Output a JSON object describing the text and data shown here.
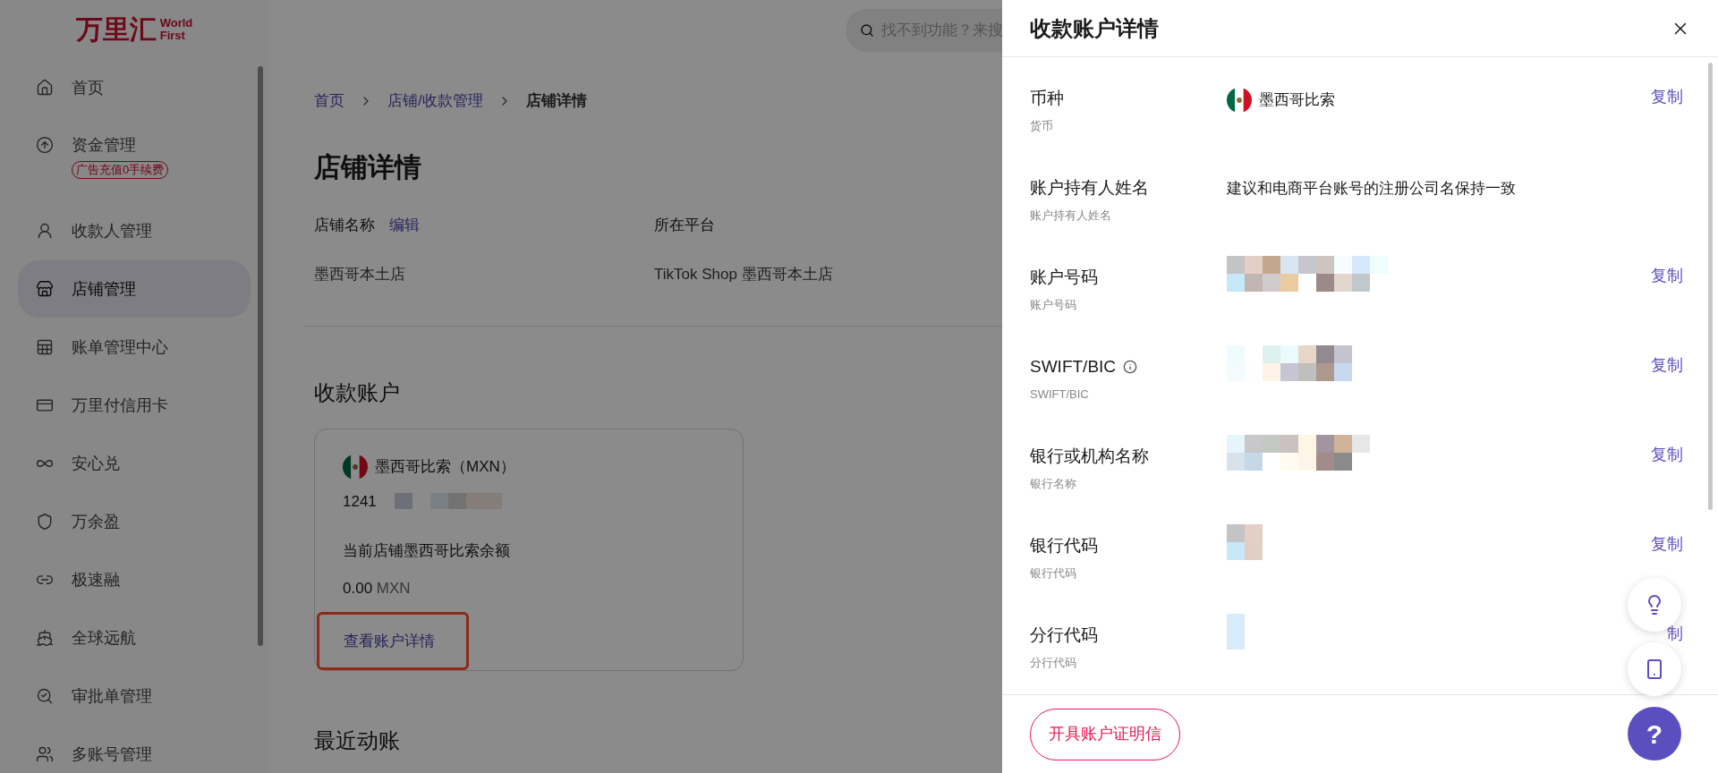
{
  "logo": {
    "cn": "万里汇",
    "en_top": "World",
    "en_bottom": "First"
  },
  "search": {
    "placeholder": "找不到功能？来搜"
  },
  "sidebar": {
    "items": [
      {
        "label": "首页",
        "selected": false
      },
      {
        "label": "资金管理",
        "selected": false,
        "badge": "广告充值0手续费"
      },
      {
        "label": "收款人管理",
        "selected": false
      },
      {
        "label": "店铺管理",
        "selected": true
      },
      {
        "label": "账单管理中心",
        "selected": false
      },
      {
        "label": "万里付信用卡",
        "selected": false
      },
      {
        "label": "安心兑",
        "selected": false
      },
      {
        "label": "万余盈",
        "selected": false
      },
      {
        "label": "极速融",
        "selected": false
      },
      {
        "label": "全球远航",
        "selected": false
      },
      {
        "label": "审批单管理",
        "selected": false
      },
      {
        "label": "多账号管理",
        "selected": false
      }
    ]
  },
  "breadcrumb": [
    {
      "label": "首页",
      "current": false
    },
    {
      "label": "店铺/收款管理",
      "current": false
    },
    {
      "label": "店铺详情",
      "current": true
    }
  ],
  "page_title": "店铺详情",
  "store_fields": [
    {
      "label": "店铺名称",
      "action": "编辑",
      "value": "墨西哥本土店"
    },
    {
      "label": "所在平台",
      "value": "TikTok Shop 墨西哥本土店"
    }
  ],
  "accounts_section": {
    "title": "收款账户",
    "card": {
      "currency": "墨西哥比索（MXN）",
      "account_prefix": "1241",
      "balance_label": "当前店铺墨西哥比索余额",
      "amount": "0.00",
      "unit": "MXN",
      "link": "查看账户详情",
      "highlighted": true
    }
  },
  "recent_title": "最近动账",
  "drawer": {
    "title": "收款账户详情",
    "rows": [
      {
        "kind": "flag",
        "label": "币种",
        "sublabel": "货币",
        "value": "墨西哥比索",
        "copy": "复制"
      },
      {
        "kind": "text",
        "label": "账户持有人姓名",
        "sublabel": "账户持有人姓名",
        "value": "建议和电商平台账号的注册公司名保持一致"
      },
      {
        "kind": "masked",
        "label": "账户号码",
        "sublabel": "账户号码",
        "copy": "复制"
      },
      {
        "kind": "masked",
        "label": "SWIFT/BIC",
        "sublabel": "SWIFT/BIC",
        "info": true,
        "copy": "复制"
      },
      {
        "kind": "masked",
        "label": "银行或机构名称",
        "sublabel": "银行名称",
        "copy": "复制"
      },
      {
        "kind": "masked",
        "label": "银行代码",
        "sublabel": "银行代码",
        "copy": "复制"
      },
      {
        "kind": "masked",
        "label": "分行代码",
        "sublabel": "分行代码",
        "copy": "制"
      }
    ],
    "footer_button": "开具账户证明信"
  },
  "help_button": "?"
}
